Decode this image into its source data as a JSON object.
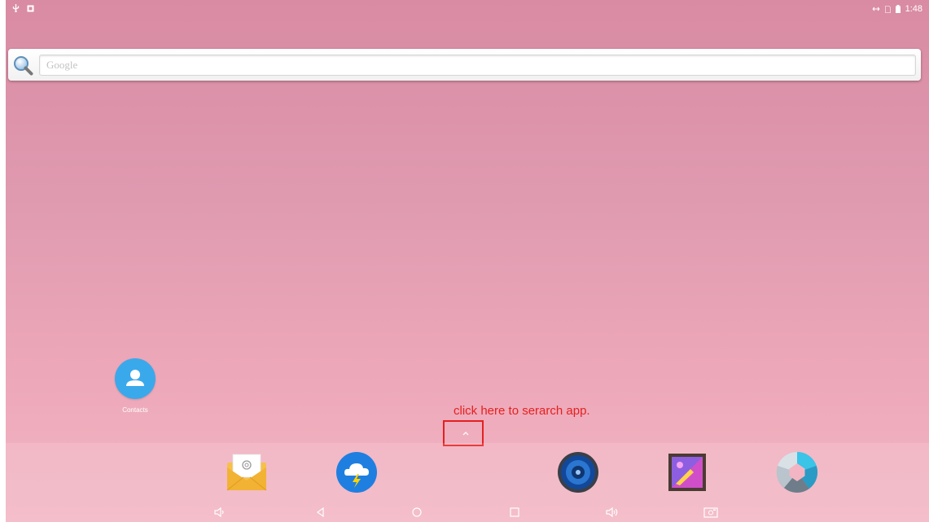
{
  "status_bar": {
    "left_icons": [
      "usb-icon",
      "notification-icon"
    ],
    "right_icons": [
      "sync-icon",
      "sim-icon",
      "battery-icon"
    ],
    "time": "1:48"
  },
  "search_bar": {
    "placeholder": "Google",
    "icon": "magnifier-icon"
  },
  "desktop": {
    "shortcuts": [
      {
        "label": "Contacts",
        "icon": "contacts-icon",
        "color": "#3aa9ec"
      }
    ]
  },
  "annotation": {
    "text": "click here to serarch app.",
    "color": "#e52020"
  },
  "all_apps": {
    "icon": "chevron-up-icon"
  },
  "dock": {
    "apps": [
      {
        "icon": "email-icon"
      },
      {
        "icon": "weather-icon"
      },
      {
        "icon": "music-icon"
      },
      {
        "icon": "gallery-icon"
      },
      {
        "icon": "camera-icon"
      }
    ]
  },
  "nav_bar": {
    "buttons": [
      "volume-down-icon",
      "back-icon",
      "home-icon",
      "recents-icon",
      "volume-up-icon",
      "screenshot-icon"
    ]
  }
}
